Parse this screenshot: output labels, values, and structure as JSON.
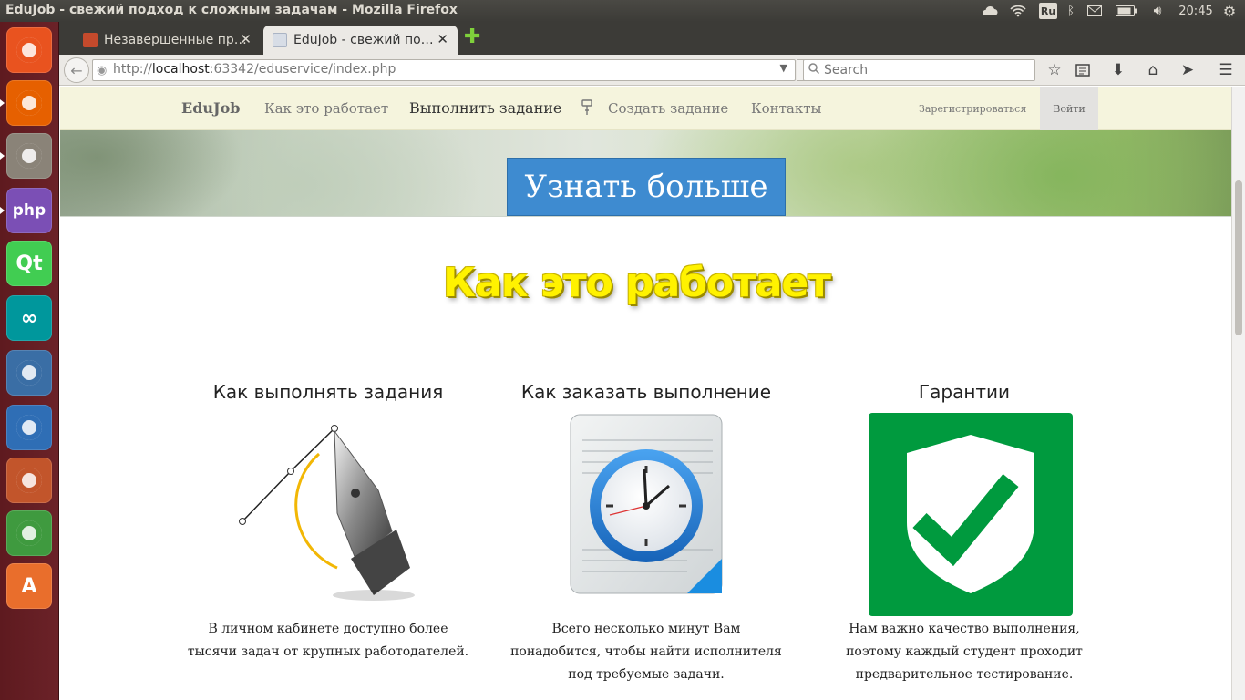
{
  "os": {
    "window_title": "EduJob - свежий подход к сложным задачам - Mozilla Firefox",
    "keyboard_layout": "Ru",
    "clock": "20:45"
  },
  "launcher": {
    "items": [
      {
        "name": "ubuntu",
        "glyph": "",
        "color": "#e9531f"
      },
      {
        "name": "firefox",
        "glyph": "",
        "color": "#e66000"
      },
      {
        "name": "files",
        "glyph": "",
        "color": "#8a8378"
      },
      {
        "name": "phpstorm",
        "glyph": "php",
        "color": "#7b4fb5"
      },
      {
        "name": "qt-creator",
        "glyph": "Qt",
        "color": "#41cd52"
      },
      {
        "name": "arduino",
        "glyph": "∞",
        "color": "#00979c"
      },
      {
        "name": "thunderbird",
        "glyph": "",
        "color": "#3a6ea5"
      },
      {
        "name": "writer",
        "glyph": "",
        "color": "#2f6eb5"
      },
      {
        "name": "impress",
        "glyph": "",
        "color": "#c2552b"
      },
      {
        "name": "calc",
        "glyph": "",
        "color": "#3f9a3f"
      },
      {
        "name": "software-center",
        "glyph": "A",
        "color": "#e96e2c"
      }
    ]
  },
  "browser": {
    "tabs": [
      {
        "title": "Незавершенные пр…",
        "active": false
      },
      {
        "title": "EduJob - свежий по…",
        "active": true
      }
    ],
    "url_prefix": "http://",
    "url_host": "localhost",
    "url_rest": ":63342/eduservice/index.php",
    "search_placeholder": "Search"
  },
  "site": {
    "brand": "EduJob",
    "menu": {
      "how_it_works": "Как это работает",
      "do_task": "Выполнить задание",
      "create_task": "Создать задание",
      "contacts": "Контакты"
    },
    "register": "Зарегистрироваться",
    "login": "Войти",
    "hero_button": "Узнать больше",
    "section_title": "Как это работает",
    "features": [
      {
        "heading": "Как выполнять задания",
        "desc_lines": [
          "В личном кабинете доступно более",
          "тысячи задач от крупных работодателей."
        ],
        "icon": "pen-tool-icon"
      },
      {
        "heading": "Как заказать выполнение",
        "desc_lines": [
          "Всего несколько минут Вам",
          "понадобится, чтобы найти исполнителя",
          "под требуемые задачи."
        ],
        "icon": "clock-document-icon"
      },
      {
        "heading": "Гарантии",
        "desc_lines": [
          "Нам важно качество выполнения,",
          "поэтому каждый студент проходит",
          "предварительное тестирование."
        ],
        "icon": "shield-check-icon"
      }
    ]
  },
  "colors": {
    "hero_button": "#3e8bd0",
    "nav_bg": "#f5f4dd",
    "section_title": "#fff200",
    "guarantee_green": "#009a3e"
  }
}
